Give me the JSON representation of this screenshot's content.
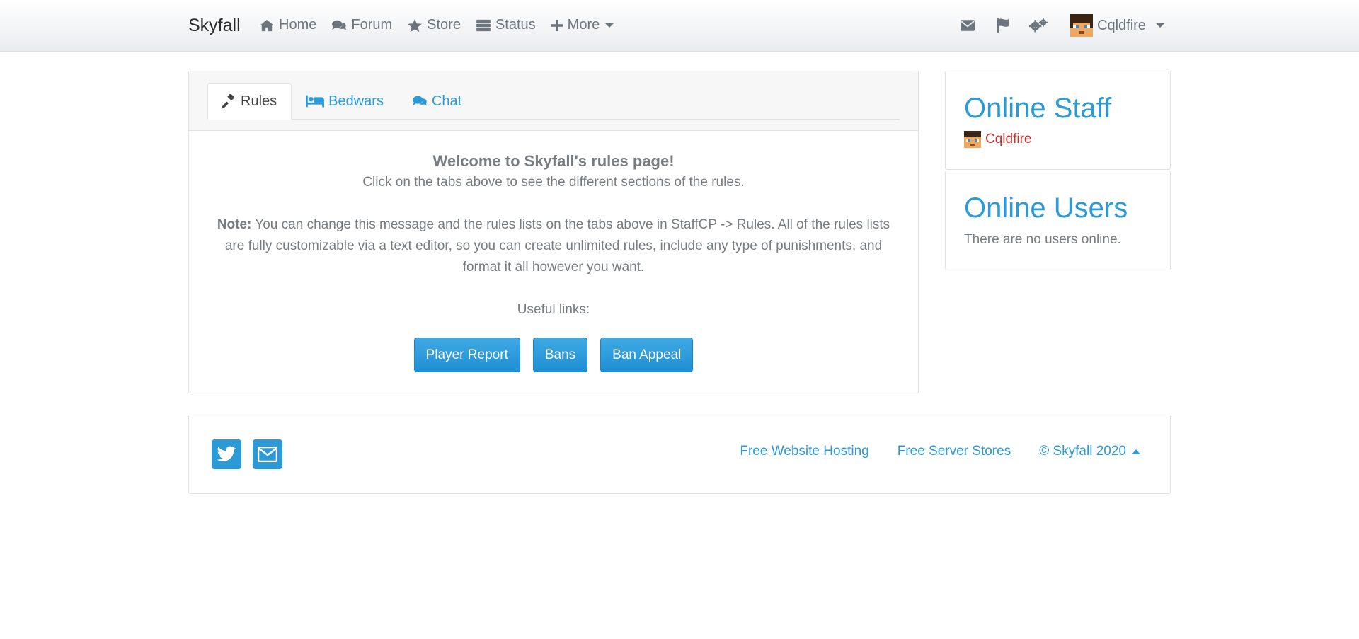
{
  "navbar": {
    "brand": "Skyfall",
    "links": [
      {
        "label": "Home",
        "icon": "home-icon"
      },
      {
        "label": "Forum",
        "icon": "comments-icon"
      },
      {
        "label": "Store",
        "icon": "star-icon"
      },
      {
        "label": "Status",
        "icon": "server-icon"
      },
      {
        "label": "More",
        "icon": "plus-icon"
      }
    ],
    "username": "Cqldfire"
  },
  "rules": {
    "tabs": [
      {
        "label": "Rules",
        "icon": "gavel-icon"
      },
      {
        "label": "Bedwars",
        "icon": "bed-icon"
      },
      {
        "label": "Chat",
        "icon": "comments-icon"
      }
    ],
    "welcome": "Welcome to Skyfall's rules page!",
    "subtitle": "Click on the tabs above to see the different sections of the rules.",
    "note_label": "Note:",
    "note_text": " You can change this message and the rules lists on the tabs above in StaffCP -> Rules. All of the rules lists are fully customizable via a text editor, so you can create unlimited rules, include any type of punishments, and format it all however you want.",
    "useful_links": "Useful links:",
    "buttons": [
      "Player Report",
      "Bans",
      "Ban Appeal"
    ]
  },
  "sidebar": {
    "staff_title": "Online Staff",
    "staff_user": "Cqldfire",
    "users_title": "Online Users",
    "users_text": "There are no users online."
  },
  "footer": {
    "links": [
      "Free Website Hosting",
      "Free Server Stores",
      "© Skyfall 2020"
    ]
  },
  "colors": {
    "accent": "#2b9ad7",
    "staff_name": "#c7302d"
  }
}
